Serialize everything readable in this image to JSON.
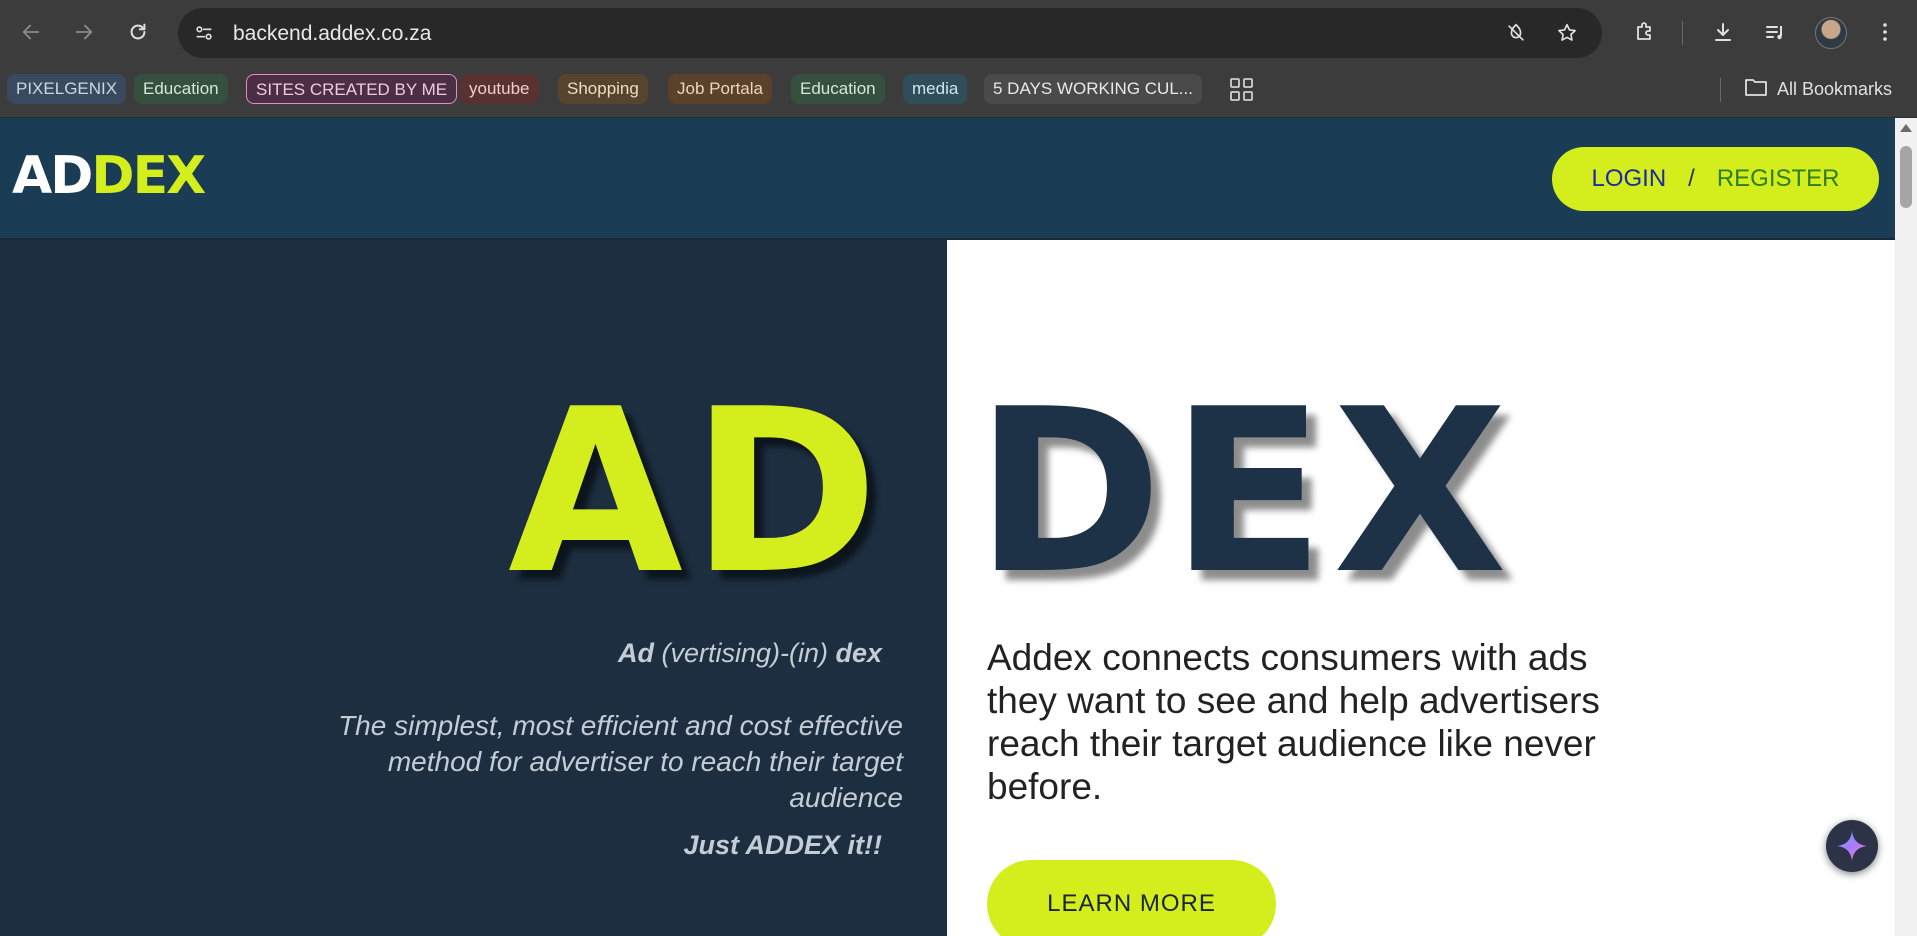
{
  "browser": {
    "url": "backend.addex.co.za",
    "bookmarks": [
      {
        "label": "PIXELGENIX",
        "bg": "#3a4a5e",
        "fg": "#c9d6e6"
      },
      {
        "label": "Education",
        "bg": "#36503f",
        "fg": "#d2e8d4"
      },
      {
        "label": "SITES CREATED BY ME",
        "bg": "#4a2f44",
        "fg": "#f2c7e4",
        "border": "#e98bc9"
      },
      {
        "label": "youtube",
        "bg": "#5a3131",
        "fg": "#f0cccc"
      },
      {
        "label": "Shopping",
        "bg": "#57442e",
        "fg": "#f0dcc2"
      },
      {
        "label": "Job Portala",
        "bg": "#5a412a",
        "fg": "#f0d4b8"
      },
      {
        "label": "Education",
        "bg": "#36503f",
        "fg": "#d2e8d4"
      },
      {
        "label": "media",
        "bg": "#304e5a",
        "fg": "#cfe6ef"
      },
      {
        "label": "5 DAYS WORKING CUL...",
        "bg": "#4a4a4a",
        "fg": "#e8e8e8"
      }
    ],
    "all_bookmarks_label": "All Bookmarks",
    "icons": [
      "back-icon",
      "forward-icon",
      "reload-icon",
      "site-info-icon",
      "tracking-off-icon",
      "star-icon",
      "extensions-icon",
      "download-icon",
      "media-control-icon",
      "profile-avatar",
      "more-vert-icon",
      "apps-grid-icon",
      "folder-icon",
      "gemini-sparkle-icon"
    ]
  },
  "site": {
    "logo": {
      "part1": "AD",
      "part2": "DEX"
    },
    "auth": {
      "login": "LOGIN",
      "separator": "/",
      "register": "REGISTER"
    },
    "hero": {
      "big_left": "AD",
      "big_right": "DEX",
      "tagline": {
        "part1": "Ad",
        "part2": " (vertising)-(in) ",
        "part3": "dex"
      },
      "description": "The simplest, most efficient and cost effective method for advertiser to reach their target audience",
      "cta_tagline": "Just ADDEX it!!",
      "about": "Addex connects consumers with ads they want to see and help advertisers reach their target audience like never before.",
      "learn_more": "LEARN MORE"
    }
  },
  "colors": {
    "brand_lime": "#d4ee1d",
    "header_bg": "#1a3c55",
    "hero_dark": "#1c2e40",
    "login_text": "#1b2aa8",
    "register_text": "#2f7d1f"
  }
}
